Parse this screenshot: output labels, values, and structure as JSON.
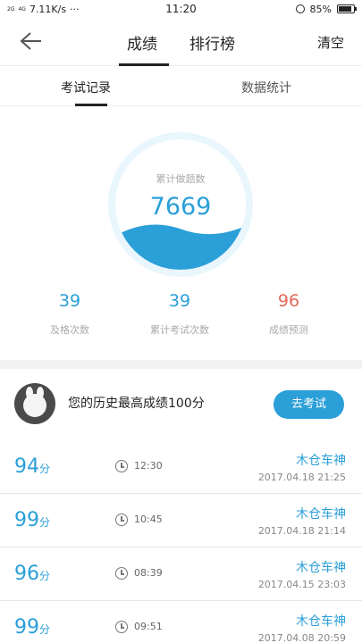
{
  "status_bar": {
    "signal_1": "2G",
    "signal_2": "4G",
    "speed": "7.11K/s",
    "dots": "···",
    "time": "11:20",
    "battery": "85%",
    "battery_level": 0.85
  },
  "header": {
    "tabs": [
      {
        "label": "成绩"
      },
      {
        "label": "排行榜"
      }
    ],
    "right_action": "清空",
    "back_icon": "back-arrow-icon"
  },
  "subtabs": [
    {
      "label": "考试记录"
    },
    {
      "label": "数据统计"
    }
  ],
  "gauge": {
    "label": "累计做题数",
    "value": "7669"
  },
  "stats": [
    {
      "value": "39",
      "label": "及格次数"
    },
    {
      "value": "39",
      "label": "累计考试次数"
    },
    {
      "value": "96",
      "label": "成绩预测"
    }
  ],
  "best": {
    "text": "您的历史最高成绩100分",
    "button": "去考试"
  },
  "records": [
    {
      "score": "94",
      "unit": "分",
      "duration": "12:30",
      "title": "木仓车神",
      "date": "2017.04.18  21:25"
    },
    {
      "score": "99",
      "unit": "分",
      "duration": "10:45",
      "title": "木仓车神",
      "date": "2017.04.18  21:14"
    },
    {
      "score": "96",
      "unit": "分",
      "duration": "08:39",
      "title": "木仓车神",
      "date": "2017.04.15  23:03"
    },
    {
      "score": "99",
      "unit": "分",
      "duration": "09:51",
      "title": "木仓车神",
      "date": "2017.04.08  20:59"
    }
  ],
  "colors": {
    "accent": "#2b9fd8",
    "prediction": "#e46a5a"
  }
}
